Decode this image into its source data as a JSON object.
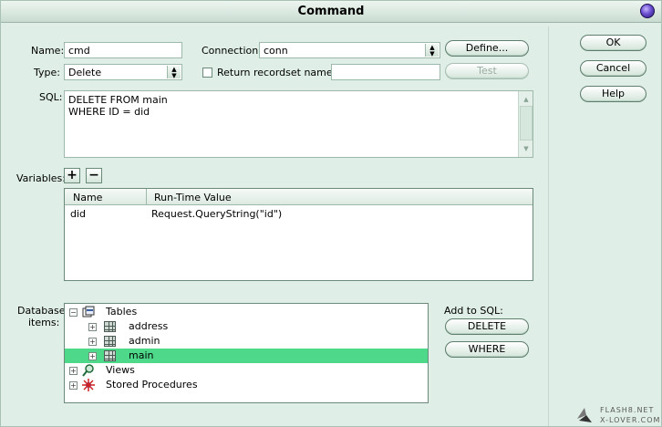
{
  "window": {
    "title": "Command"
  },
  "form": {
    "name_label": "Name:",
    "name_value": "cmd",
    "type_label": "Type:",
    "type_value": "Delete",
    "connection_label": "Connection:",
    "connection_value": "conn",
    "define_label": "Define...",
    "return_recordset_label": "Return recordset named:",
    "return_recordset_value": "",
    "test_label": "Test",
    "sql_label": "SQL:",
    "sql_text": "DELETE FROM main\nWHERE ID = did"
  },
  "variables": {
    "label": "Variables:",
    "add_symbol": "+",
    "remove_symbol": "−",
    "columns": [
      "Name",
      "Run-Time Value"
    ],
    "rows": [
      {
        "name": "did",
        "value": "Request.QueryString(\"id\")"
      }
    ]
  },
  "database": {
    "label_line1": "Database",
    "label_line2": "items:",
    "tree": {
      "tables": "Tables",
      "table_items": [
        "address",
        "admin",
        "main"
      ],
      "views": "Views",
      "procedures": "Stored Procedures"
    },
    "add_to_sql_label": "Add to SQL:",
    "delete_label": "DELETE",
    "where_label": "WHERE"
  },
  "side_buttons": {
    "ok": "OK",
    "cancel": "Cancel",
    "help": "Help"
  },
  "watermark": {
    "line1": "FLASH8.NET",
    "line2": "X-LOVER.COM"
  },
  "colors": {
    "window_bg": "#dfeee6",
    "selection": "#4ed98a"
  }
}
